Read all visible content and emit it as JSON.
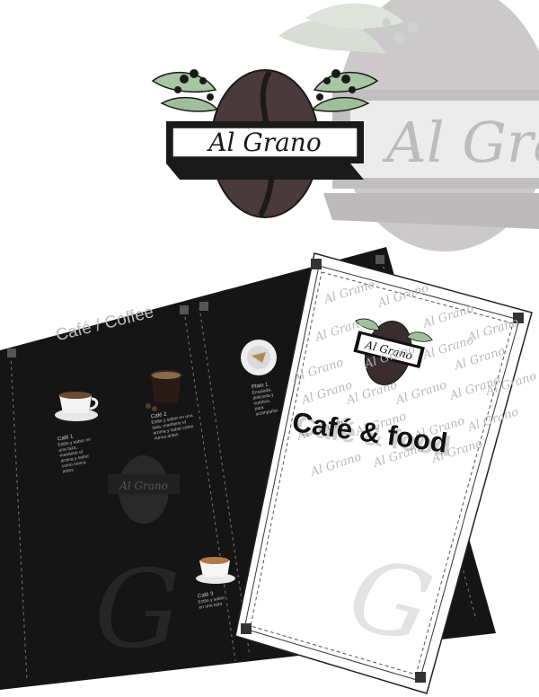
{
  "brand": {
    "name": "Al Grano",
    "colors": {
      "bean": "#4a3a3c",
      "bean_dark": "#2a2224",
      "leaf": "#a9c6a4",
      "ghost": "#c8c6c6",
      "menu_bg": "#151515",
      "menu_text": "#cfcfcf"
    }
  },
  "cover": {
    "title": "Café & food",
    "watermark": "Al Grano"
  },
  "inside": {
    "heading": "Café / Coffee",
    "items": [
      {
        "title": "Café 1",
        "desc": "Estilo y sabor en una taza, mantiene el aroma y sabor como nunca antes",
        "icon": "coffee-cup-icon"
      },
      {
        "title": "Café 2",
        "desc": "Estilo y sabor en una taza, mantiene el aroma y sabor como nunca antes",
        "icon": "espresso-glass-icon"
      },
      {
        "title": "Plato 1",
        "desc": "Ensalada, deliciosa y nutritiva, para acompañar un café",
        "icon": "plate-icon"
      },
      {
        "title": "Café 3",
        "desc": "Estilo y sabor en una taza",
        "icon": "espresso-cup-icon"
      }
    ]
  }
}
